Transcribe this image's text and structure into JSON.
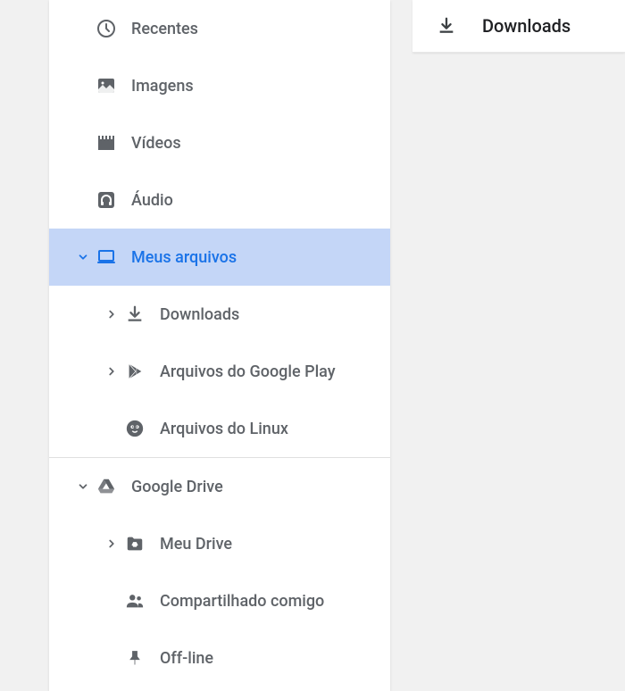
{
  "sidebar": {
    "items": [
      {
        "label": "Recentes"
      },
      {
        "label": "Imagens"
      },
      {
        "label": "Vídeos"
      },
      {
        "label": "Áudio"
      },
      {
        "label": "Meus arquivos"
      },
      {
        "label": "Downloads"
      },
      {
        "label": "Arquivos do Google Play"
      },
      {
        "label": "Arquivos do Linux"
      },
      {
        "label": "Google Drive"
      },
      {
        "label": "Meu Drive"
      },
      {
        "label": "Compartilhado comigo"
      },
      {
        "label": "Off-line"
      }
    ]
  },
  "header": {
    "title": "Downloads"
  }
}
